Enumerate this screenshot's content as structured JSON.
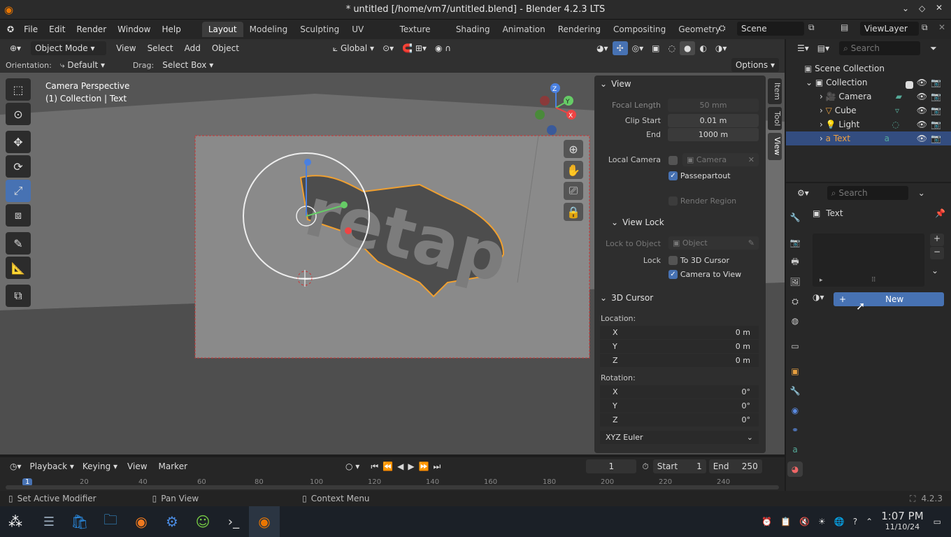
{
  "window": {
    "title": "* untitled [/home/vm7/untitled.blend] - Blender 4.2.3 LTS"
  },
  "menu": {
    "items": [
      "File",
      "Edit",
      "Render",
      "Window",
      "Help"
    ]
  },
  "workspaces": [
    "Layout",
    "Modeling",
    "Sculpting",
    "UV Editing",
    "Texture Paint",
    "Shading",
    "Animation",
    "Rendering",
    "Compositing",
    "Geometry Noc"
  ],
  "scene": {
    "name": "Scene",
    "view_layer": "ViewLayer"
  },
  "viewport_header": {
    "mode": "Object Mode",
    "menus": [
      "View",
      "Select",
      "Add",
      "Object"
    ],
    "transform": "Global",
    "orientation_label": "Orientation:",
    "orientation_value": "Default",
    "drag_label": "Drag:",
    "drag_value": "Select Box",
    "options": "Options"
  },
  "viewport": {
    "overlay_title": "Camera Perspective",
    "overlay_sub": "(1) Collection | Text",
    "text_object": "retap"
  },
  "npanel": {
    "view_header": "View",
    "focal_length_label": "Focal Length",
    "focal_length": "50 mm",
    "clip_start_label": "Clip Start",
    "clip_start": "0.01 m",
    "end_label": "End",
    "clip_end": "1000 m",
    "local_camera_label": "Local Camera",
    "local_camera_value": "Camera",
    "passepartout": "Passepartout",
    "render_region": "Render Region",
    "view_lock_header": "View Lock",
    "lock_to_object_label": "Lock to Object",
    "lock_to_object_placeholder": "Object",
    "lock_label": "Lock",
    "to_3d_cursor": "To 3D Cursor",
    "camera_to_view": "Camera to View",
    "cursor_header": "3D Cursor",
    "location_label": "Location:",
    "loc": [
      {
        "axis": "X",
        "value": "0 m"
      },
      {
        "axis": "Y",
        "value": "0 m"
      },
      {
        "axis": "Z",
        "value": "0 m"
      }
    ],
    "rotation_label": "Rotation:",
    "rot": [
      {
        "axis": "X",
        "value": "0°"
      },
      {
        "axis": "Y",
        "value": "0°"
      },
      {
        "axis": "Z",
        "value": "0°"
      }
    ],
    "rotation_mode": "XYZ Euler",
    "tabs": [
      "Item",
      "Tool",
      "View"
    ]
  },
  "outliner": {
    "search_placeholder": "Search",
    "scene_collection": "Scene Collection",
    "collection": "Collection",
    "objects": [
      "Camera",
      "Cube",
      "Light",
      "Text"
    ]
  },
  "properties": {
    "search_placeholder": "Search",
    "object_name": "Text",
    "new_button": "New"
  },
  "timeline": {
    "menus": [
      "Playback",
      "Keying",
      "View",
      "Marker"
    ],
    "current_frame": "1",
    "start_label": "Start",
    "start": "1",
    "end_label": "End",
    "end": "250",
    "ruler": [
      "1",
      "20",
      "40",
      "60",
      "80",
      "100",
      "120",
      "140",
      "160",
      "180",
      "200",
      "220",
      "240"
    ]
  },
  "statusbar": {
    "left": "Set Active Modifier",
    "middle": "Pan View",
    "right": "Context Menu",
    "version": "4.2.3"
  },
  "taskbar": {
    "time": "1:07 PM",
    "date": "11/10/24"
  }
}
